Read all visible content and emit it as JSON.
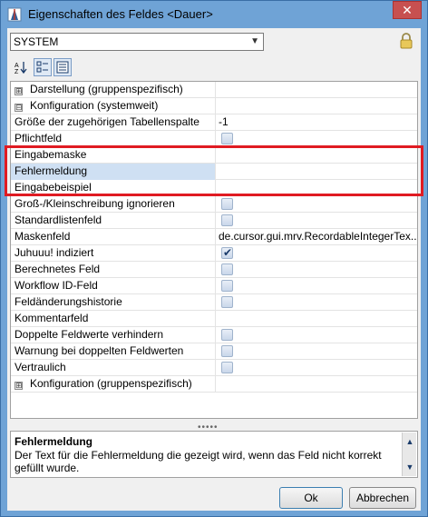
{
  "window": {
    "title": "Eigenschaften des Feldes <Dauer>",
    "close_label": "✕"
  },
  "selector": {
    "value": "SYSTEM"
  },
  "toolbar": {
    "sort_label": "A↓Z"
  },
  "rows": [
    {
      "name": "Darstellung (gruppenspezifisch)",
      "value": "",
      "kind": "group",
      "expander": "⊞"
    },
    {
      "name": "Konfiguration (systemweit)",
      "value": "",
      "kind": "group",
      "expander": "⊟"
    },
    {
      "name": "Größe der zugehörigen Tabellenspalte",
      "value": "-1",
      "kind": "text"
    },
    {
      "name": "Pflichtfeld",
      "value": "",
      "kind": "checkbox",
      "checked": false
    },
    {
      "name": "Eingabemaske",
      "value": "",
      "kind": "text"
    },
    {
      "name": "Fehlermeldung",
      "value": "",
      "kind": "text",
      "selected": true
    },
    {
      "name": "Eingabebeispiel",
      "value": "",
      "kind": "text"
    },
    {
      "name": "Groß-/Kleinschreibung ignorieren",
      "value": "",
      "kind": "checkbox",
      "checked": false
    },
    {
      "name": "Standardlistenfeld",
      "value": "",
      "kind": "checkbox",
      "checked": false
    },
    {
      "name": "Maskenfeld",
      "value": "de.cursor.gui.mrv.RecordableIntegerTex...",
      "kind": "text"
    },
    {
      "name": "Juhuuu! indiziert",
      "value": "",
      "kind": "checkbox",
      "checked": true
    },
    {
      "name": "Berechnetes Feld",
      "value": "",
      "kind": "checkbox",
      "checked": false
    },
    {
      "name": "Workflow ID-Feld",
      "value": "",
      "kind": "checkbox",
      "checked": false
    },
    {
      "name": "Feldänderungshistorie",
      "value": "",
      "kind": "checkbox",
      "checked": false
    },
    {
      "name": "Kommentarfeld",
      "value": "",
      "kind": "text"
    },
    {
      "name": "Doppelte Feldwerte verhindern",
      "value": "",
      "kind": "checkbox",
      "checked": false
    },
    {
      "name": "Warnung bei doppelten Feldwerten",
      "value": "",
      "kind": "checkbox",
      "checked": false
    },
    {
      "name": "Vertraulich",
      "value": "",
      "kind": "checkbox",
      "checked": false
    },
    {
      "name": "Konfiguration (gruppenspezifisch)",
      "value": "",
      "kind": "group",
      "expander": "⊞"
    }
  ],
  "description": {
    "title": "Fehlermeldung",
    "text": "Der Text für die Fehlermeldung die gezeigt wird, wenn das Feld nicht korrekt gefüllt wurde."
  },
  "buttons": {
    "ok": "Ok",
    "cancel": "Abbrechen"
  },
  "colors": {
    "highlight": "#e01b22",
    "selected_row": "#cfe0f3",
    "titlebar": "#6fa3d6"
  }
}
